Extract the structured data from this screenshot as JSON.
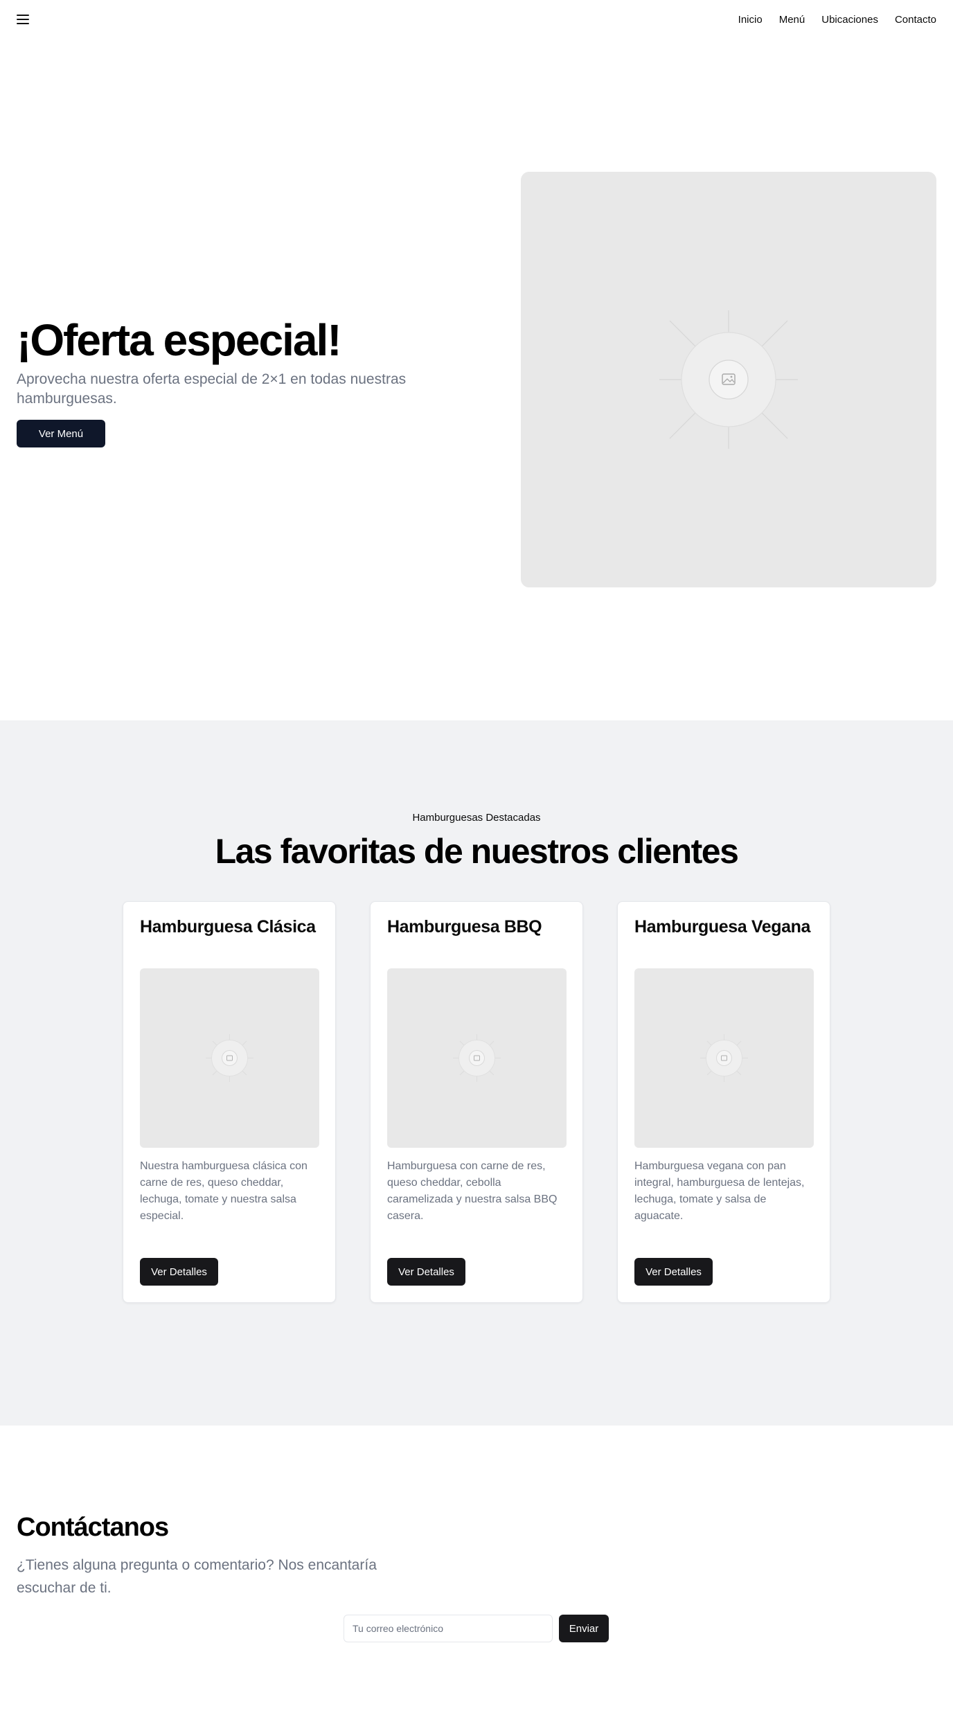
{
  "header": {
    "menu_icon": "hamburger-menu-icon",
    "nav": [
      {
        "label": "Inicio"
      },
      {
        "label": "Menú"
      },
      {
        "label": "Ubicaciones"
      },
      {
        "label": "Contacto"
      }
    ]
  },
  "hero": {
    "title": "¡Oferta especial!",
    "subtitle": "Aprovecha nuestra oferta especial de 2×1 en todas nuestras hamburguesas.",
    "button_label": "Ver Menú",
    "image_icon": "image-placeholder-icon"
  },
  "featured": {
    "eyebrow": "Hamburguesas Destacadas",
    "title": "Las favoritas de nuestros clientes",
    "cards": [
      {
        "title": "Hamburguesa Clásica",
        "description": "Nuestra hamburguesa clásica con carne de res, queso cheddar, lechuga, tomate y nuestra salsa especial.",
        "button_label": "Ver Detalles"
      },
      {
        "title": "Hamburguesa BBQ",
        "description": "Hamburguesa con carne de res, queso cheddar, cebolla caramelizada y nuestra salsa BBQ casera.",
        "button_label": "Ver Detalles"
      },
      {
        "title": "Hamburguesa Vegana",
        "description": "Hamburguesa vegana con pan integral, hamburguesa de lentejas, lechuga, tomate y salsa de aguacate.",
        "button_label": "Ver Detalles"
      }
    ]
  },
  "contact": {
    "title": "Contáctanos",
    "subtitle": "¿Tienes alguna pregunta o comentario? Nos encantaría escuchar de ti.",
    "email_placeholder": "Tu correo electrónico",
    "email_value": "",
    "send_label": "Enviar"
  },
  "colors": {
    "primary_button": "#0f172a",
    "card_button": "#18181b",
    "section_bg": "#f1f2f4",
    "muted_text": "#6b7280",
    "placeholder_bg": "#e8e8e8"
  }
}
